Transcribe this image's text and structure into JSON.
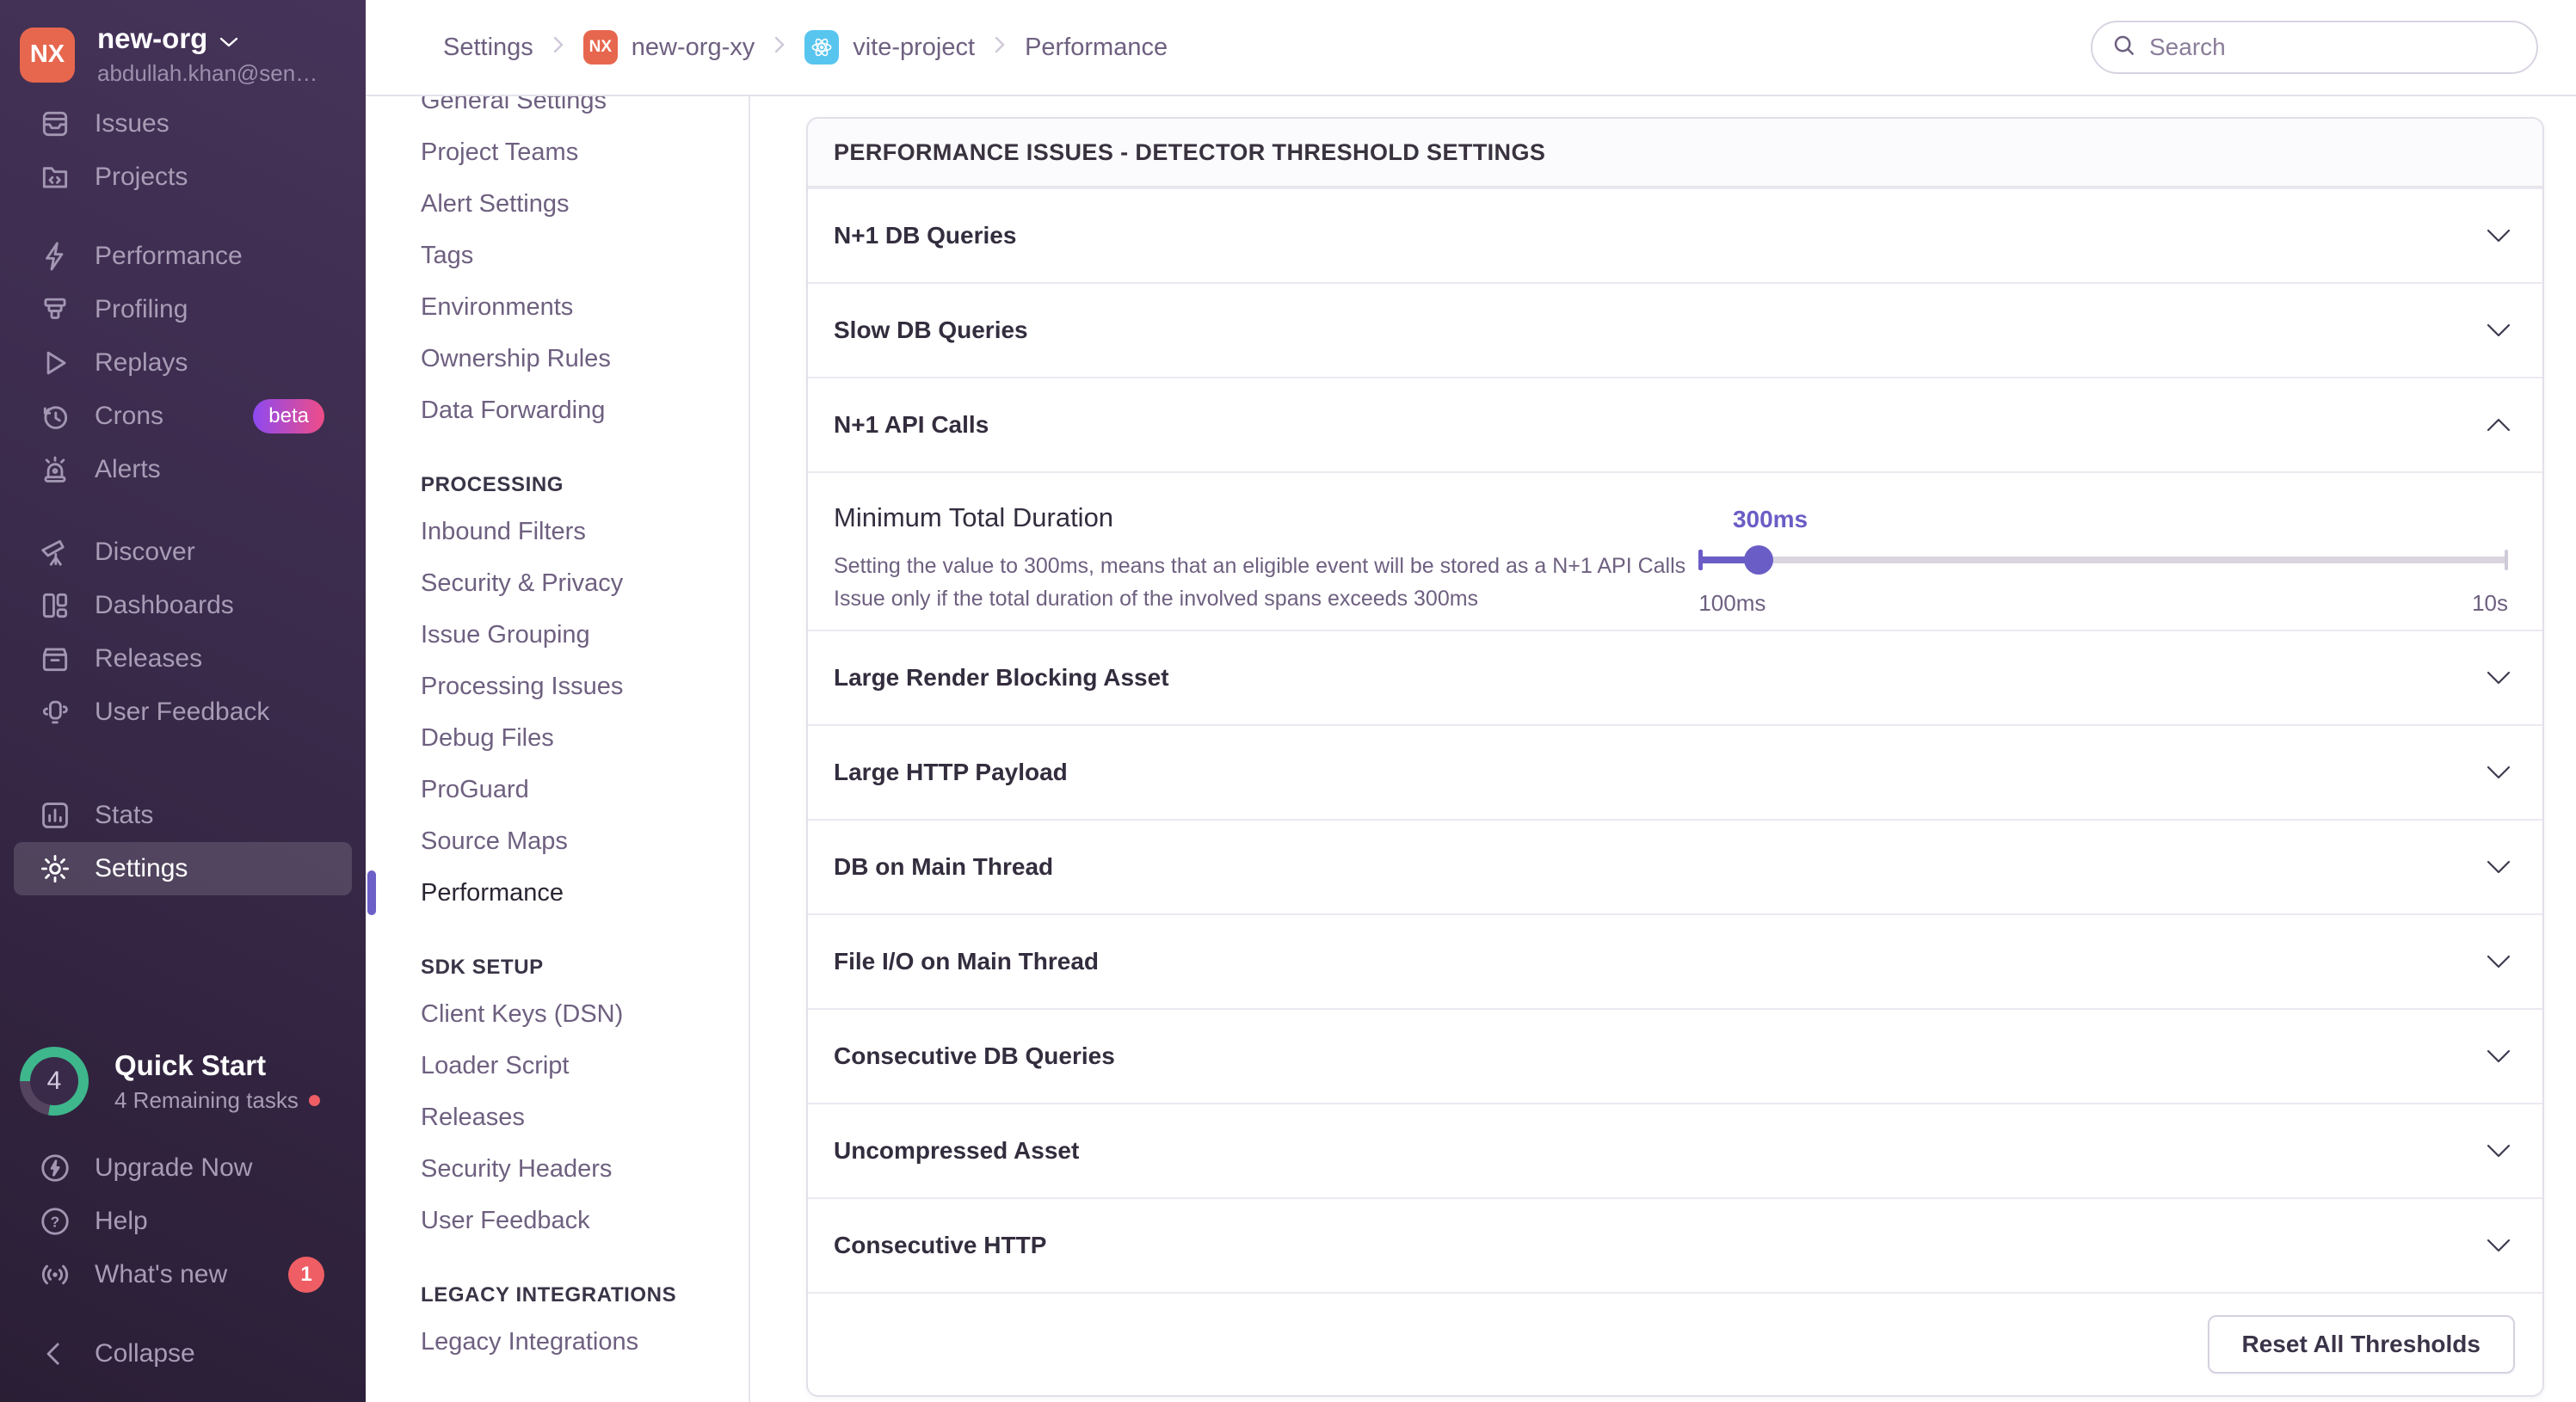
{
  "colors": {
    "accent_purple": "#6C5FC7",
    "sidebar_gradient_top": "#463359",
    "sidebar_gradient_bottom": "#2A1E35",
    "org_avatar_bg": "#E7674E",
    "project_icon_bg": "#58C5EF",
    "beta_badge_start": "#8D49F0",
    "beta_badge_end": "#EF4D87",
    "alert_red": "#EE5E64",
    "quickstart_green": "#3EB78C"
  },
  "sidebar": {
    "org": {
      "initials": "NX",
      "name": "new-org",
      "email": "abdullah.khan@sen…"
    },
    "groups": [
      {
        "items": [
          {
            "icon": "issues-icon",
            "label": "Issues"
          },
          {
            "icon": "projects-icon",
            "label": "Projects"
          }
        ]
      },
      {
        "items": [
          {
            "icon": "performance-icon",
            "label": "Performance"
          },
          {
            "icon": "profiling-icon",
            "label": "Profiling"
          },
          {
            "icon": "replays-icon",
            "label": "Replays"
          },
          {
            "icon": "crons-icon",
            "label": "Crons",
            "badge": "beta"
          },
          {
            "icon": "alerts-icon",
            "label": "Alerts"
          }
        ]
      },
      {
        "items": [
          {
            "icon": "discover-icon",
            "label": "Discover"
          },
          {
            "icon": "dashboards-icon",
            "label": "Dashboards"
          },
          {
            "icon": "releases-icon",
            "label": "Releases"
          },
          {
            "icon": "user-feedback-icon",
            "label": "User Feedback"
          }
        ]
      },
      {
        "items": [
          {
            "icon": "stats-icon",
            "label": "Stats"
          },
          {
            "icon": "settings-icon",
            "label": "Settings"
          }
        ]
      }
    ],
    "quick_start": {
      "count": "4",
      "title": "Quick Start",
      "subtitle": "4 Remaining tasks"
    },
    "footer_items": [
      {
        "icon": "upgrade-icon",
        "label": "Upgrade Now"
      },
      {
        "icon": "help-icon",
        "label": "Help"
      },
      {
        "icon": "whats-new-icon",
        "label": "What's new",
        "badge": "1"
      }
    ],
    "collapse_label": "Collapse"
  },
  "topbar": {
    "breadcrumbs": [
      {
        "label": "Settings"
      },
      {
        "label": "new-org-xy",
        "badge": "NX"
      },
      {
        "label": "vite-project",
        "badge": "react"
      },
      {
        "label": "Performance"
      }
    ],
    "search_placeholder": "Search"
  },
  "settings_nav": {
    "top_items": [
      "General Settings",
      "Project Teams",
      "Alert Settings",
      "Tags",
      "Environments",
      "Ownership Rules",
      "Data Forwarding"
    ],
    "sections": [
      {
        "title": "PROCESSING",
        "items": [
          "Inbound Filters",
          "Security & Privacy",
          "Issue Grouping",
          "Processing Issues",
          "Debug Files",
          "ProGuard",
          "Source Maps",
          "Performance"
        ],
        "active_item": "Performance"
      },
      {
        "title": "SDK SETUP",
        "items": [
          "Client Keys (DSN)",
          "Loader Script",
          "Releases",
          "Security Headers",
          "User Feedback"
        ]
      },
      {
        "title": "LEGACY INTEGRATIONS",
        "items": [
          "Legacy Integrations"
        ]
      }
    ]
  },
  "panel": {
    "title": "PERFORMANCE ISSUES - DETECTOR THRESHOLD SETTINGS",
    "rows": [
      {
        "label": "N+1 DB Queries",
        "state": "collapsed"
      },
      {
        "label": "Slow DB Queries",
        "state": "collapsed"
      },
      {
        "label": "N+1 API Calls",
        "state": "expanded"
      },
      {
        "label": "Large Render Blocking Asset",
        "state": "collapsed"
      },
      {
        "label": "Large HTTP Payload",
        "state": "collapsed"
      },
      {
        "label": "DB on Main Thread",
        "state": "collapsed"
      },
      {
        "label": "File I/O on Main Thread",
        "state": "collapsed"
      },
      {
        "label": "Consecutive DB Queries",
        "state": "collapsed"
      },
      {
        "label": "Uncompressed Asset",
        "state": "collapsed"
      },
      {
        "label": "Consecutive HTTP",
        "state": "collapsed"
      }
    ],
    "detail": {
      "label": "Minimum Total Duration",
      "description": "Setting the value to 300ms, means that an eligible event will be stored as a N+1 API Calls Issue only if the total duration of the involved spans exceeds 300ms",
      "slider": {
        "value": "300ms",
        "min": "100ms",
        "max": "10s",
        "percent": 7.4
      }
    },
    "footer_button": "Reset All Thresholds"
  }
}
